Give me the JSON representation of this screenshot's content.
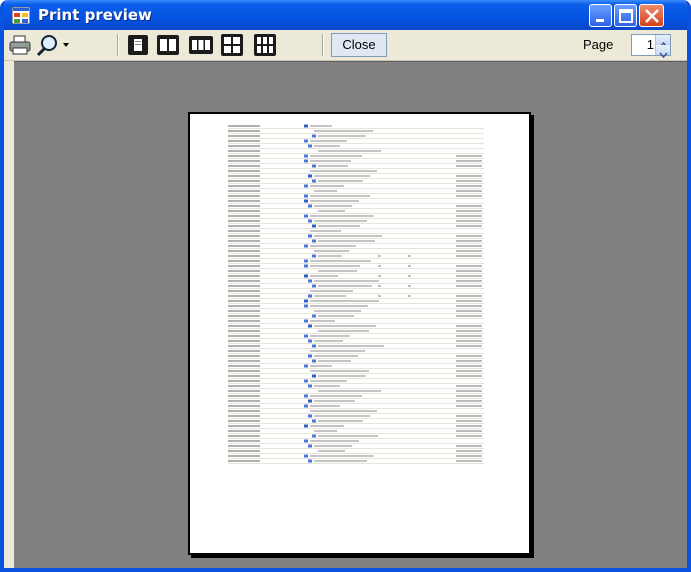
{
  "window": {
    "title": "Print preview"
  },
  "toolbar": {
    "print_icon": "printer-icon",
    "zoom_icon": "magnifier-icon",
    "layouts": [
      "one-page-icon",
      "two-pages-icon",
      "three-pages-icon",
      "four-pages-icon",
      "six-pages-icon"
    ],
    "close_label": "Close",
    "page_label": "Page",
    "page_value": "1"
  },
  "colors": {
    "title_bar": "#0554e3",
    "preview_bg": "#808080",
    "close_cap": "#d2421a"
  },
  "document": {
    "row_count": 68,
    "content": "miniature rows of unreadable log text"
  }
}
